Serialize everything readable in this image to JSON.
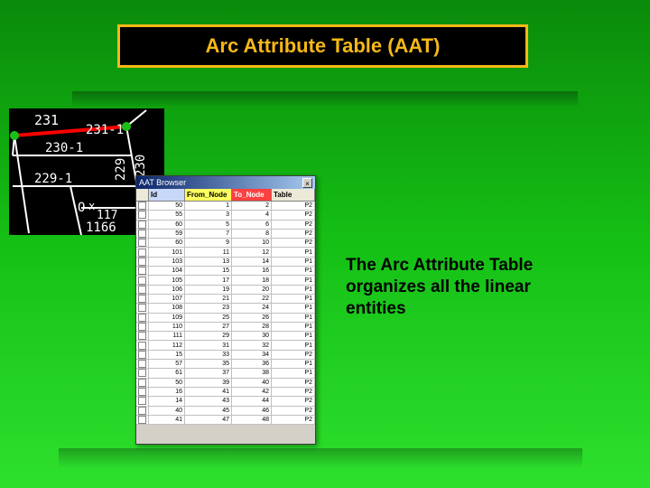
{
  "title": "Arc Attribute Table (AAT)",
  "caption": "The Arc Attribute Table organizes all the linear entities",
  "map": {
    "labels": {
      "n231": "231",
      "arc231_1": "231-1",
      "n230": "230",
      "arc230_1": "230-1",
      "arc229_1": "229-1",
      "v229": "229",
      "v230": "230",
      "n1166": "1166",
      "n117": "117",
      "o_label": "O"
    }
  },
  "aat": {
    "window_title": "AAT Browser",
    "close": "×",
    "headers": {
      "id": "Id",
      "from_node": "From_Node",
      "to_node": "To_Node",
      "table": "Table"
    },
    "rows": [
      {
        "id": "50",
        "from": "1",
        "to": "2",
        "table": "P2"
      },
      {
        "id": "55",
        "from": "3",
        "to": "4",
        "table": "P2"
      },
      {
        "id": "60",
        "from": "5",
        "to": "6",
        "table": "P2"
      },
      {
        "id": "59",
        "from": "7",
        "to": "8",
        "table": "P2"
      },
      {
        "id": "60",
        "from": "9",
        "to": "10",
        "table": "P2"
      },
      {
        "id": "101",
        "from": "11",
        "to": "12",
        "table": "P1"
      },
      {
        "id": "103",
        "from": "13",
        "to": "14",
        "table": "P1"
      },
      {
        "id": "104",
        "from": "15",
        "to": "16",
        "table": "P1"
      },
      {
        "id": "105",
        "from": "17",
        "to": "18",
        "table": "P1"
      },
      {
        "id": "106",
        "from": "19",
        "to": "20",
        "table": "P1"
      },
      {
        "id": "107",
        "from": "21",
        "to": "22",
        "table": "P1"
      },
      {
        "id": "108",
        "from": "23",
        "to": "24",
        "table": "P1"
      },
      {
        "id": "109",
        "from": "25",
        "to": "26",
        "table": "P1"
      },
      {
        "id": "110",
        "from": "27",
        "to": "28",
        "table": "P1"
      },
      {
        "id": "111",
        "from": "29",
        "to": "30",
        "table": "P1"
      },
      {
        "id": "112",
        "from": "31",
        "to": "32",
        "table": "P1"
      },
      {
        "id": "15",
        "from": "33",
        "to": "34",
        "table": "P2"
      },
      {
        "id": "57",
        "from": "35",
        "to": "36",
        "table": "P1"
      },
      {
        "id": "61",
        "from": "37",
        "to": "38",
        "table": "P1"
      },
      {
        "id": "50",
        "from": "39",
        "to": "40",
        "table": "P2"
      },
      {
        "id": "16",
        "from": "41",
        "to": "42",
        "table": "P2"
      },
      {
        "id": "14",
        "from": "43",
        "to": "44",
        "table": "P2"
      },
      {
        "id": "40",
        "from": "45",
        "to": "46",
        "table": "P2"
      },
      {
        "id": "41",
        "from": "47",
        "to": "48",
        "table": "P2"
      }
    ]
  }
}
